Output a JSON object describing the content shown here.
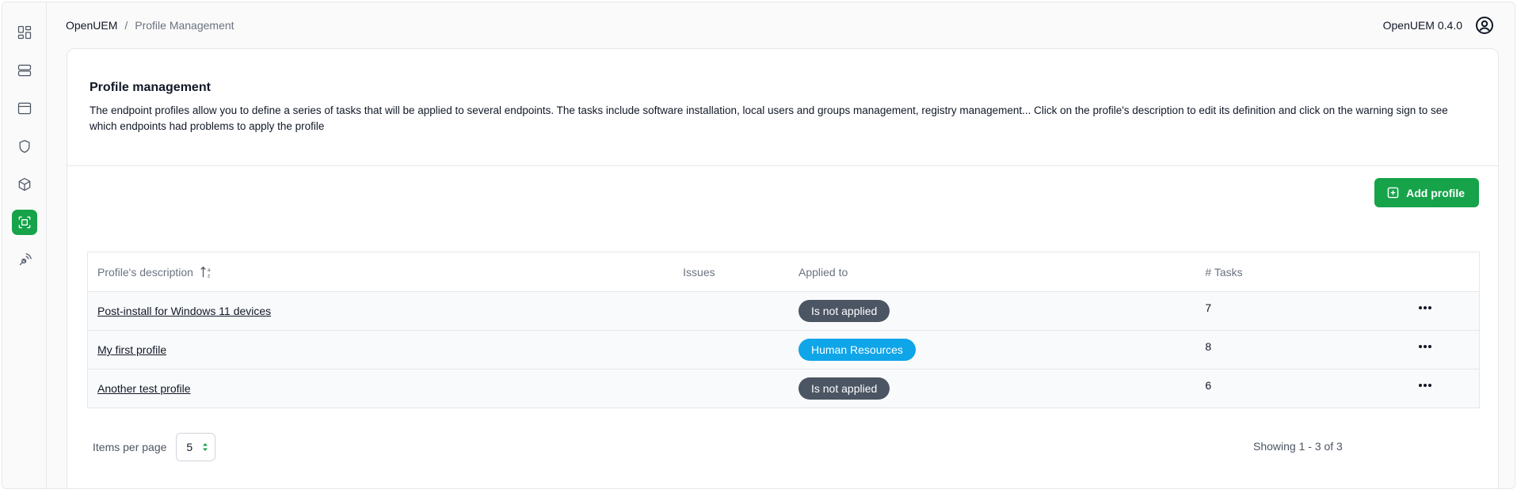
{
  "breadcrumb": {
    "root": "OpenUEM",
    "separator": "/",
    "current": "Profile Management"
  },
  "header": {
    "version": "OpenUEM 0.4.0"
  },
  "sidebar": {
    "items": [
      {
        "icon": "dashboard-icon"
      },
      {
        "icon": "computers-icon"
      },
      {
        "icon": "browser-window-icon"
      },
      {
        "icon": "shield-icon"
      },
      {
        "icon": "package-icon"
      },
      {
        "icon": "profiles-icon",
        "active": true
      },
      {
        "icon": "remote-signal-icon"
      }
    ]
  },
  "card": {
    "title": "Profile management",
    "description": "The endpoint profiles allow you to define a series of tasks that will be applied to several endpoints. The tasks include software installation, local users and groups management, registry management... Click on the profile's description to edit its definition and click on the warning sign to see which endpoints had problems to apply the profile"
  },
  "actions": {
    "add_profile": "Add profile"
  },
  "table": {
    "columns": {
      "description": "Profile's description",
      "issues": "Issues",
      "applied_to": "Applied to",
      "tasks": "# Tasks"
    },
    "rows": [
      {
        "description": "Post-install for Windows 11 devices",
        "issues": "",
        "applied_to": "Is not applied",
        "applied_color": "#4b5563",
        "tasks": "7"
      },
      {
        "description": "My first profile",
        "issues": "",
        "applied_to": "Human Resources",
        "applied_color": "#0ea5e9",
        "tasks": "8"
      },
      {
        "description": "Another test profile",
        "issues": "",
        "applied_to": "Is not applied",
        "applied_color": "#4b5563",
        "tasks": "6"
      }
    ]
  },
  "pagination": {
    "items_per_page_label": "Items per page",
    "items_per_page_value": "5",
    "showing": "Showing 1 - 3 of 3"
  },
  "colors": {
    "accent": "#16a34a",
    "badge_neutral": "#4b5563",
    "badge_info": "#0ea5e9"
  }
}
